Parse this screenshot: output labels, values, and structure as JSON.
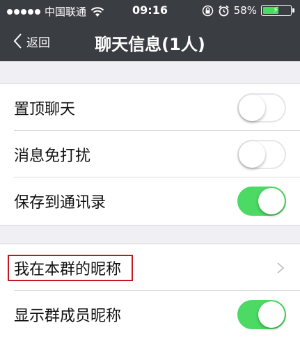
{
  "status_bar": {
    "carrier": "中国联通",
    "time": "09:16",
    "battery_percent": "58%",
    "battery_level": 0.58
  },
  "nav": {
    "back_label": "返回",
    "title": "聊天信息(1人)"
  },
  "settings": [
    {
      "label": "置顶聊天",
      "state": "off"
    },
    {
      "label": "消息免打扰",
      "state": "off"
    },
    {
      "label": "保存到通讯录",
      "state": "on"
    }
  ],
  "group_settings": {
    "nickname_label": "我在本群的昵称",
    "show_member_names_label": "显示群成员昵称",
    "show_member_names_state": "on"
  },
  "colors": {
    "header_bg": "#3a3d42",
    "switch_on": "#4cd964",
    "highlight_border": "#c0181e"
  }
}
